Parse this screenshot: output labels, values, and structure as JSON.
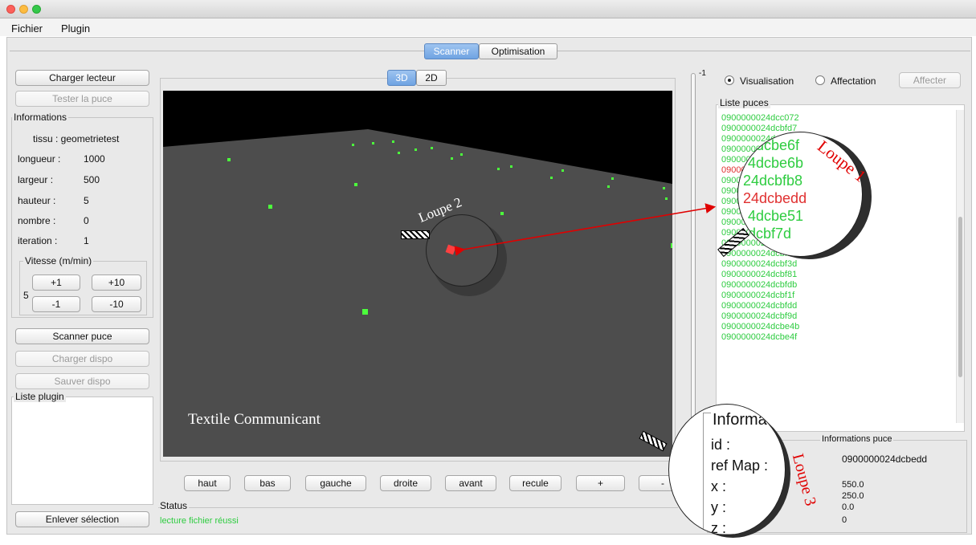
{
  "menu": {
    "items": [
      "Fichier",
      "Plugin"
    ]
  },
  "tabs": [
    "Scanner",
    "Optimisation"
  ],
  "left": {
    "charger_lecteur": "Charger lecteur",
    "tester_la_puce": "Tester la puce",
    "informations_title": "Informations",
    "tissu": "tissu : geometrietest",
    "rows": [
      {
        "label": "longueur :",
        "value": "1000"
      },
      {
        "label": "largeur :",
        "value": "500"
      },
      {
        "label": "hauteur :",
        "value": "5"
      },
      {
        "label": "nombre :",
        "value": "0"
      },
      {
        "label": "iteration :",
        "value": "1"
      }
    ],
    "vitesse_title": "Vitesse (m/min)",
    "vitesse_value": "5",
    "speed_buttons": [
      "+1",
      "+10",
      "-1",
      "-10"
    ],
    "scanner_puce": "Scanner puce",
    "charger_dispo": "Charger dispo",
    "sauver_dispo": "Sauver dispo",
    "liste_plugin": "Liste plugin",
    "enlever_selection": "Enlever sélection"
  },
  "view": {
    "toggle": [
      "3D",
      "2D"
    ],
    "label": "Textile Communicant",
    "loupe2": "Loupe 2",
    "nav_buttons": [
      "haut",
      "bas",
      "gauche",
      "droite",
      "avant",
      "recule",
      "+",
      "-"
    ],
    "status_title": "Status",
    "status_text": "lecture fichier réussi"
  },
  "slider": {
    "top_label": "-1",
    "bottom_label": "0"
  },
  "right": {
    "mode_visualisation": "Visualisation",
    "mode_affectation": "Affectation",
    "affecter": "Affecter",
    "liste_puces_title": "Liste puces",
    "puces": [
      "0900000024dcc072",
      "0900000024dcbfd7",
      "0900000024dcbe6f",
      "0900000024dcbe6b",
      "0900000024dcbfb8",
      "0900000024dcbedd",
      "0900000024dcbe51",
      "0900000024dcbf7d",
      "0900000024dcc035",
      "0900000024dcc039",
      "0900000024dcc074",
      "0900000024dcbefd",
      "0900000024dcbe0e",
      "0900000024dcbfba",
      "0900000024dcbf3d",
      "0900000024dcbf81",
      "0900000024dcbfdb",
      "0900000024dcbf1f",
      "0900000024dcbfdd",
      "0900000024dcbf9d",
      "0900000024dcbe4b",
      "0900000024dcbe4f"
    ],
    "loupe1_label": "Loupe 1",
    "loupe1_rows": [
      "4dcbe6f",
      "4dcbe6b",
      "24dcbfb8",
      "24dcbedd",
      "4dcbe51",
      "dcbf7d"
    ],
    "info_title": "Informations puce",
    "info_values": [
      "0900000024dcbedd",
      "550.0",
      "250.0",
      "0.0",
      "0"
    ],
    "loupe3_label": "Loupe 3",
    "loupe3_title": "Informa",
    "loupe3_rows": [
      "id :",
      "ref Map :",
      "x :",
      "y :",
      "z :"
    ]
  },
  "colors": {
    "accent": "#5b9bd5",
    "list_green": "#2ecc40",
    "selected_red": "#e03030",
    "loupe_label_red": "#e00000"
  }
}
